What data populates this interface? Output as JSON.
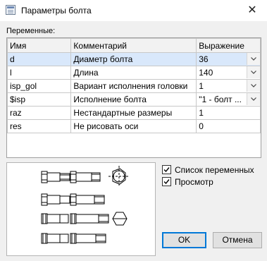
{
  "window": {
    "title": "Параметры болта",
    "close_glyph": "✕",
    "icon": "table-app-icon"
  },
  "variables_label": "Переменные:",
  "table": {
    "columns": [
      "Имя",
      "Комментарий",
      "Выражение"
    ],
    "rows": [
      {
        "name": "d",
        "comment": "Диаметр болта",
        "value": "36",
        "has_dropdown": true
      },
      {
        "name": "l",
        "comment": "Длина",
        "value": "140",
        "has_dropdown": true
      },
      {
        "name": "isp_gol",
        "comment": "Вариант исполнения головки",
        "value": "1",
        "has_dropdown": true
      },
      {
        "name": "$isp",
        "comment": "Исполнение болта",
        "value": "\"1 - болт ...",
        "has_dropdown": true
      },
      {
        "name": "raz",
        "comment": "Нестандартные  размеры",
        "value": "1",
        "has_dropdown": false
      },
      {
        "name": "res",
        "comment": "Не рисовать оси",
        "value": "0",
        "has_dropdown": false
      }
    ],
    "selected_row": 0
  },
  "options": {
    "show_vars_label": "Список переменных",
    "show_vars_checked": true,
    "preview_label": "Просмотр",
    "preview_checked": true
  },
  "buttons": {
    "ok": "OK",
    "cancel": "Отмена"
  },
  "colors": {
    "selected_row": "#d9e8fb",
    "default_button_border": "#0078d7"
  }
}
